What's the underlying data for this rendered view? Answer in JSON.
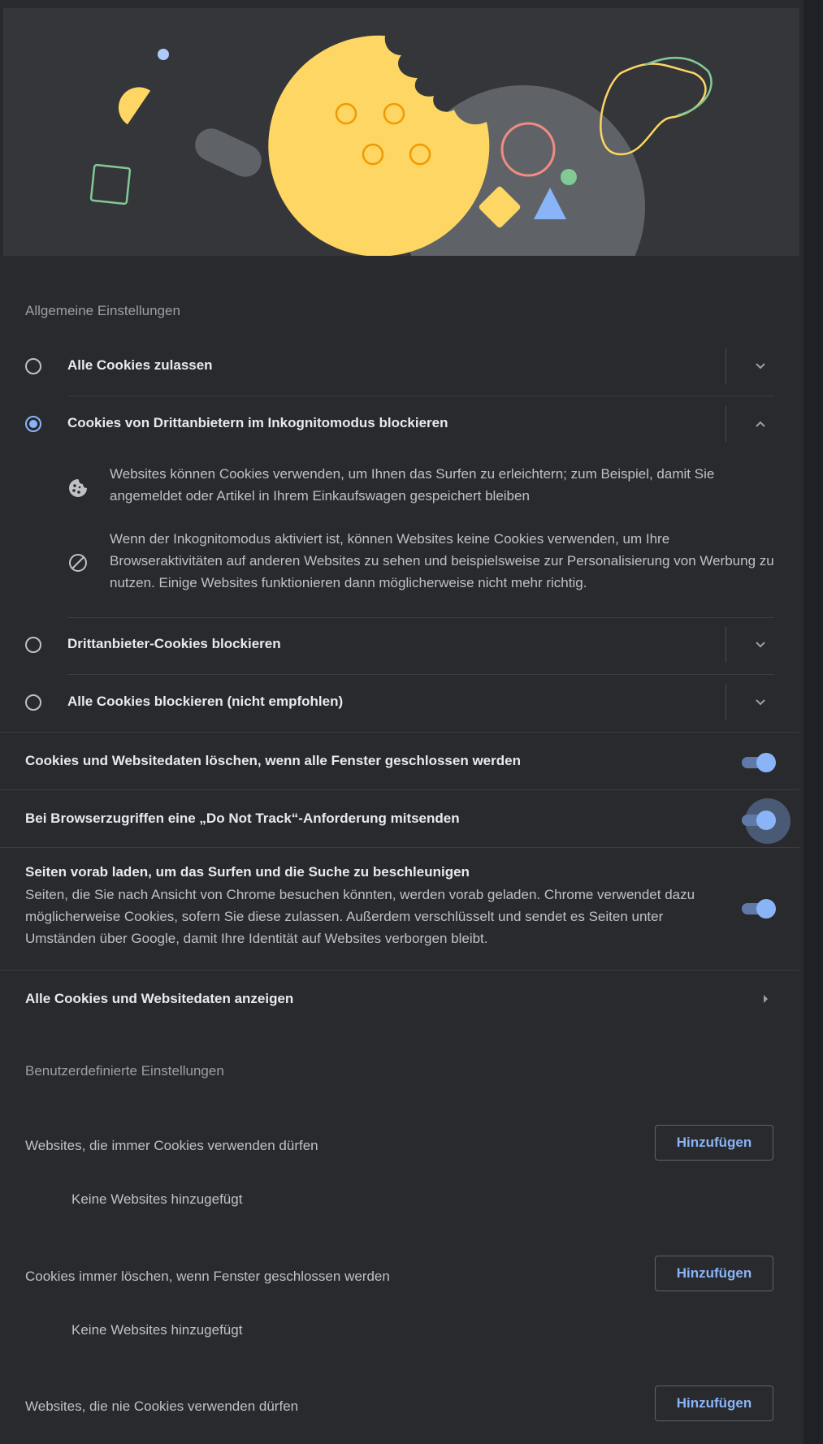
{
  "general": {
    "title": "Allgemeine Einstellungen",
    "options": [
      {
        "label": "Alle Cookies zulassen",
        "selected": false,
        "expanded": false
      },
      {
        "label": "Cookies von Drittanbietern im Inkognitomodus blockieren",
        "selected": true,
        "expanded": true
      },
      {
        "label": "Drittanbieter-Cookies blockieren",
        "selected": false,
        "expanded": false
      },
      {
        "label": "Alle Cookies blockieren (nicht empfohlen)",
        "selected": false,
        "expanded": false
      }
    ],
    "details": [
      {
        "icon": "cookie-icon",
        "text": "Websites können Cookies verwenden, um Ihnen das Surfen zu erleichtern; zum Beispiel, damit Sie angemeldet oder Artikel in Ihrem Einkaufswagen gespeichert bleiben"
      },
      {
        "icon": "block-icon",
        "text": "Wenn der Inkognitomodus aktiviert ist, können Websites keine Cookies verwenden, um Ihre Browseraktivitäten auf anderen Websites zu sehen und beispielsweise zur Personalisierung von Werbung zu nutzen. Einige Websites funktionieren dann möglicherweise nicht mehr richtig."
      }
    ]
  },
  "toggles": {
    "clear_on_close": {
      "label": "Cookies und Websitedaten löschen, wenn alle Fenster geschlossen werden",
      "on": true
    },
    "do_not_track": {
      "label": "Bei Browserzugriffen eine „Do Not Track“-Anforderung mitsenden",
      "on": true
    },
    "preload": {
      "label": "Seiten vorab laden, um das Surfen und die Suche zu beschleunigen",
      "description": "Seiten, die Sie nach Ansicht von Chrome besuchen könnten, werden vorab geladen. Chrome verwendet dazu möglicherweise Cookies, sofern Sie diese zulassen. Außerdem verschlüsselt und sendet es Seiten unter Umständen über Google, damit Ihre Identität auf Websites verborgen bleibt.",
      "on": true
    }
  },
  "all_cookies_link": {
    "label": "Alle Cookies und Websitedaten anzeigen"
  },
  "custom": {
    "title": "Benutzerdefinierte Einstellungen",
    "lists": [
      {
        "label": "Websites, die immer Cookies verwenden dürfen",
        "button": "Hinzufügen",
        "empty": "Keine Websites hinzugefügt"
      },
      {
        "label": "Cookies immer löschen, wenn Fenster geschlossen werden",
        "button": "Hinzufügen",
        "empty": "Keine Websites hinzugefügt"
      },
      {
        "label": "Websites, die nie Cookies verwenden dürfen",
        "button": "Hinzufügen"
      }
    ]
  },
  "colors": {
    "background": "#292a2d",
    "accent": "#8ab4f8",
    "cookie": "#fdd663"
  }
}
